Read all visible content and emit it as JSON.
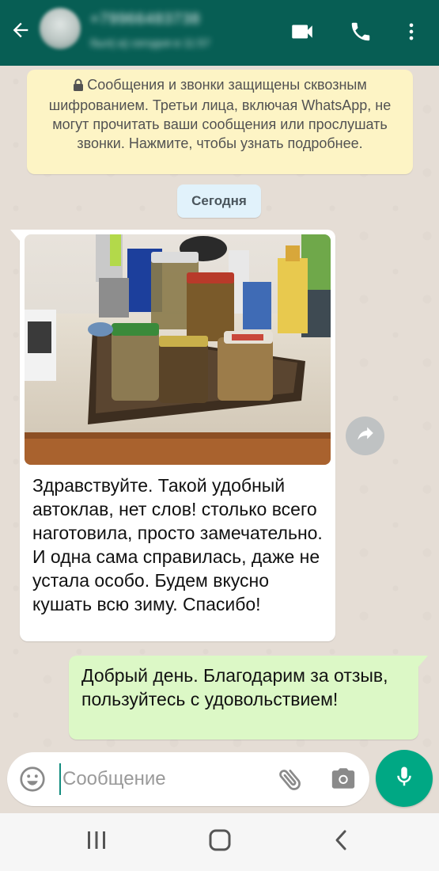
{
  "header": {
    "contact_name": "+79966483738",
    "contact_status": "был(-а) сегодня в 11:57",
    "icons": [
      "back-arrow-icon",
      "video-call-icon",
      "voice-call-icon",
      "more-options-icon"
    ],
    "bg_color": "#075e54"
  },
  "chat": {
    "encryption_notice": "Сообщения и звонки защищены сквозным шифрованием. Третьи лица, включая WhatsApp, не могут прочитать ваши сообщения или прослушать звонки. Нажмите, чтобы узнать подробнее.",
    "date_chip": "Сегодня",
    "messages": [
      {
        "direction": "incoming",
        "has_photo": true,
        "text": "Здравствуйте. Такой удобный автоклав, нет слов! столько всего наготовила, просто замечательно. И одна сама справилась, даже не устала особо. Будем вкусно кушать всю зиму. Спасибо!"
      },
      {
        "direction": "outgoing",
        "text": "Добрый день. Благодарим за отзыв, пользуйтесь с удовольствием!"
      }
    ]
  },
  "composer": {
    "placeholder": "Сообщение",
    "value": "",
    "accent_color": "#00a884"
  },
  "colors": {
    "incoming_bubble": "#ffffff",
    "outgoing_bubble": "#dcf8c6",
    "notice_bg": "#fdf4c5",
    "date_chip_bg": "#e1f2fb"
  }
}
